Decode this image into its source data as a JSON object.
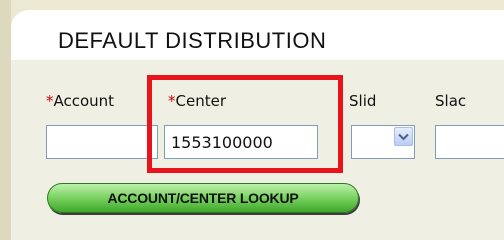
{
  "section": {
    "title": "DEFAULT DISTRIBUTION"
  },
  "fields": {
    "required_marker": "*",
    "account": {
      "label": "Account",
      "value": ""
    },
    "center": {
      "label": "Center",
      "value": "1553100000"
    },
    "slid": {
      "label": "Slid",
      "value": ""
    },
    "slac": {
      "label": "Slac",
      "value": ""
    }
  },
  "buttons": {
    "lookup_label": "ACCOUNT/CENTER LOOKUP"
  },
  "colors": {
    "highlight": "#e8141c",
    "required": "#cc0000",
    "button_green": "#7fd566",
    "input_border": "#7f9db9"
  },
  "icons": {
    "slid_dropdown": "chevron-down-icon"
  }
}
